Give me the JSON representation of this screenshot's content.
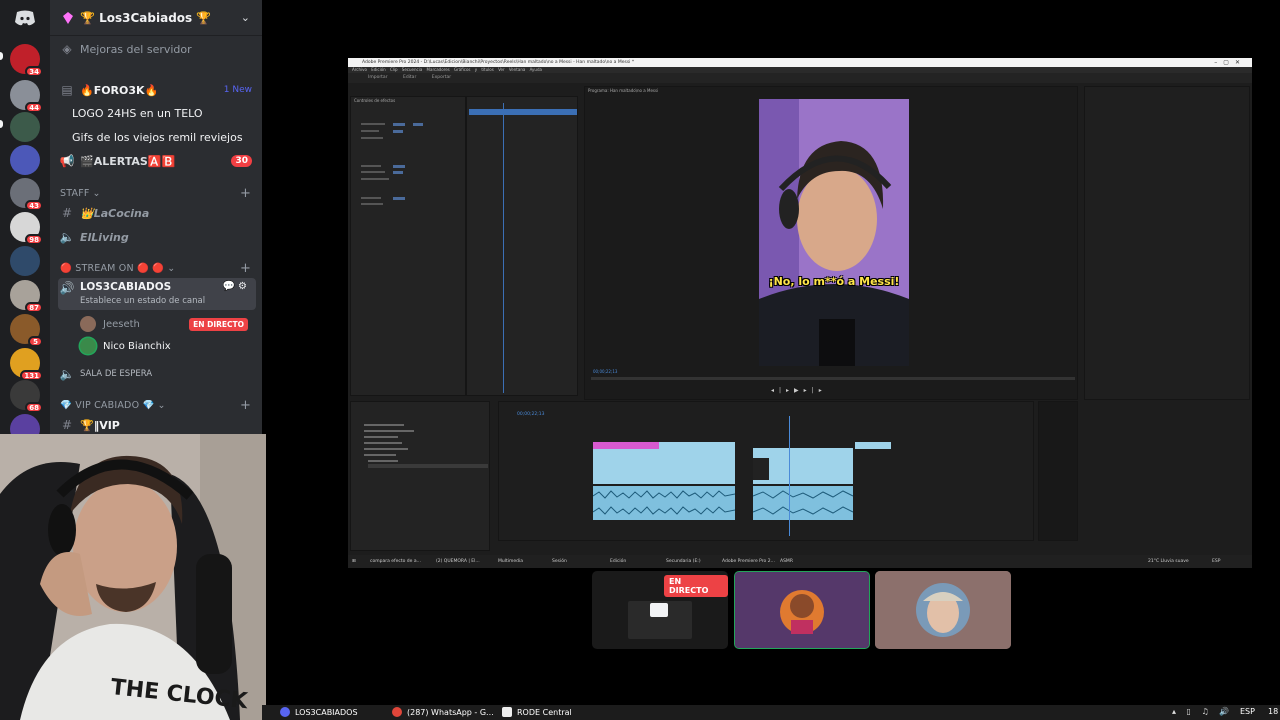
{
  "server": {
    "name": "🏆 Los3Cabiados 🏆"
  },
  "sidebar": {
    "boost": "Mejoras del servidor",
    "channels": [
      {
        "label": "🔥FORO3K🔥",
        "badge": "1 New"
      },
      {
        "label": "LOGO 24HS en un TELO"
      },
      {
        "label": "Gifs de los viejos remil reviejos"
      },
      {
        "label": "🎬ALERTAS🅰️🅱️",
        "badge": "30"
      }
    ],
    "staff": {
      "category": "STAFF",
      "channels": [
        "👑LaCocina",
        "ElLiving"
      ]
    },
    "stream": {
      "category": "🔴 STREAM ON 🔴 🔴",
      "voice_channel": "LOS3CABIADOS",
      "status": "Establece un estado de canal",
      "users": [
        {
          "name": "Jeeseth",
          "live": "EN DIRECTO"
        },
        {
          "name": "Nico Bianchix"
        }
      ],
      "waiting": "SALA DE ESPERA"
    },
    "vip": {
      "category": "💎 VIP CABIADO 💎",
      "channel": "🏆‖VIP"
    }
  },
  "rail": {
    "badges": [
      "34",
      "44",
      "43",
      "98",
      "87",
      "5",
      "131",
      "68"
    ]
  },
  "premiere": {
    "window_title": "Adobe Premiere Pro 2024 - D:\\Lucas\\Edicion\\Bianchi\\Proyectos\\Reels\\Han maltado\\no a Messi - Han maltado\\no a Messi *",
    "menu": "Archivo Edición Clip Secuencia Marcadores Gráficos y títulos Ver Ventana Ayuda",
    "tabs": "Importar Editar Exportar",
    "panel_effects": "Controles de efectos",
    "panel_program": "Programa: Han maltado\\no a Messi",
    "subtitle": "¡No, lo m**ó a Messi!",
    "timecode": "00;00;22;13",
    "taskbar_items": [
      "compara efecto de a...",
      "(2) QUEMORA | El...",
      "Multimedia",
      "Sesión",
      "Edición",
      "Secundaria (E:)",
      "Adobe Premiere Pro 2...",
      "ASMR"
    ],
    "weather": "21°C Lluvia suave",
    "lang": "ESP"
  },
  "tiles": {
    "live_label": "EN DIRECTO"
  },
  "os_taskbar": {
    "items": [
      "LOS3CABIADOS",
      "(287) WhatsApp - G...",
      "RODE Central"
    ],
    "lang": "ESP",
    "time": "18"
  },
  "colors": {
    "accent": "#5865f2",
    "live": "#ed4245",
    "sidebar": "#2b2d31",
    "rail": "#1e1f22"
  }
}
